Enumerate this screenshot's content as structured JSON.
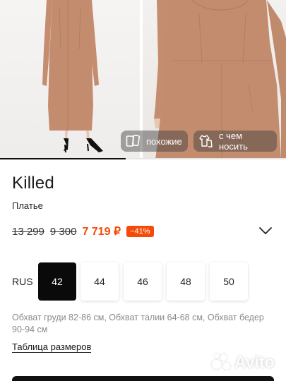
{
  "gallery": {
    "photo_count": 2,
    "progress_fraction": 0.44,
    "chips": {
      "similar": {
        "label": "похожие",
        "icon": "similar-cards-icon"
      },
      "what_to_wear": {
        "label": "с чем носить",
        "icon": "outfit-icon"
      }
    }
  },
  "product": {
    "brand": "Killed",
    "category": "Платье",
    "prices": {
      "original": "13 299",
      "previous": "9 300",
      "current": "7 719 ₽",
      "discount": "−41%"
    }
  },
  "sizes": {
    "system": "RUS",
    "options": [
      "42",
      "44",
      "46",
      "48",
      "50"
    ],
    "selected": "42"
  },
  "measurements": "Обхват груди 82-86 см, Обхват талии 64-68 см, Обхват бедер 90-94 см",
  "size_table_link": "Таблица размеров",
  "watermark": {
    "text": "Avito"
  },
  "colors": {
    "accent": "#f64a08",
    "dress": "#c08a6e",
    "selected_size": "#0a0a0a"
  }
}
